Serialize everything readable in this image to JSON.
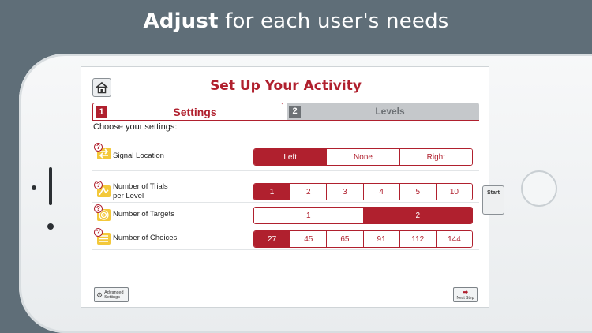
{
  "headline": {
    "bold": "Adjust",
    "rest": "for each user's needs"
  },
  "app": {
    "title": "Set Up Your Activity",
    "tabs": [
      {
        "number": "1",
        "label": "Settings",
        "active": true
      },
      {
        "number": "2",
        "label": "Levels",
        "active": false
      }
    ],
    "prompt": "Choose your settings:",
    "settings": [
      {
        "label": "Signal Location",
        "icon": "arrows-icon",
        "options": [
          "Left",
          "None",
          "Right"
        ],
        "selected": "Left"
      },
      {
        "label": "Number of Trials",
        "label2": "per Level",
        "icon": "trials-icon",
        "options": [
          "1",
          "2",
          "3",
          "4",
          "5",
          "10"
        ],
        "selected": "1"
      },
      {
        "label": "Number of Targets",
        "icon": "target-icon",
        "options": [
          "1",
          "2"
        ],
        "selected": "2"
      },
      {
        "label": "Number of Choices",
        "icon": "list-icon",
        "options": [
          "27",
          "45",
          "65",
          "91",
          "112",
          "144"
        ],
        "selected": "27"
      }
    ],
    "help_glyph": "?",
    "advanced_label_1": "Advanced",
    "advanced_label_2": "Settings",
    "next_label": "Next Step",
    "start_label": "Start",
    "colors": {
      "accent": "#b0202e",
      "highlight": "#f3c83a",
      "start_arrow": "#7dc242"
    }
  }
}
